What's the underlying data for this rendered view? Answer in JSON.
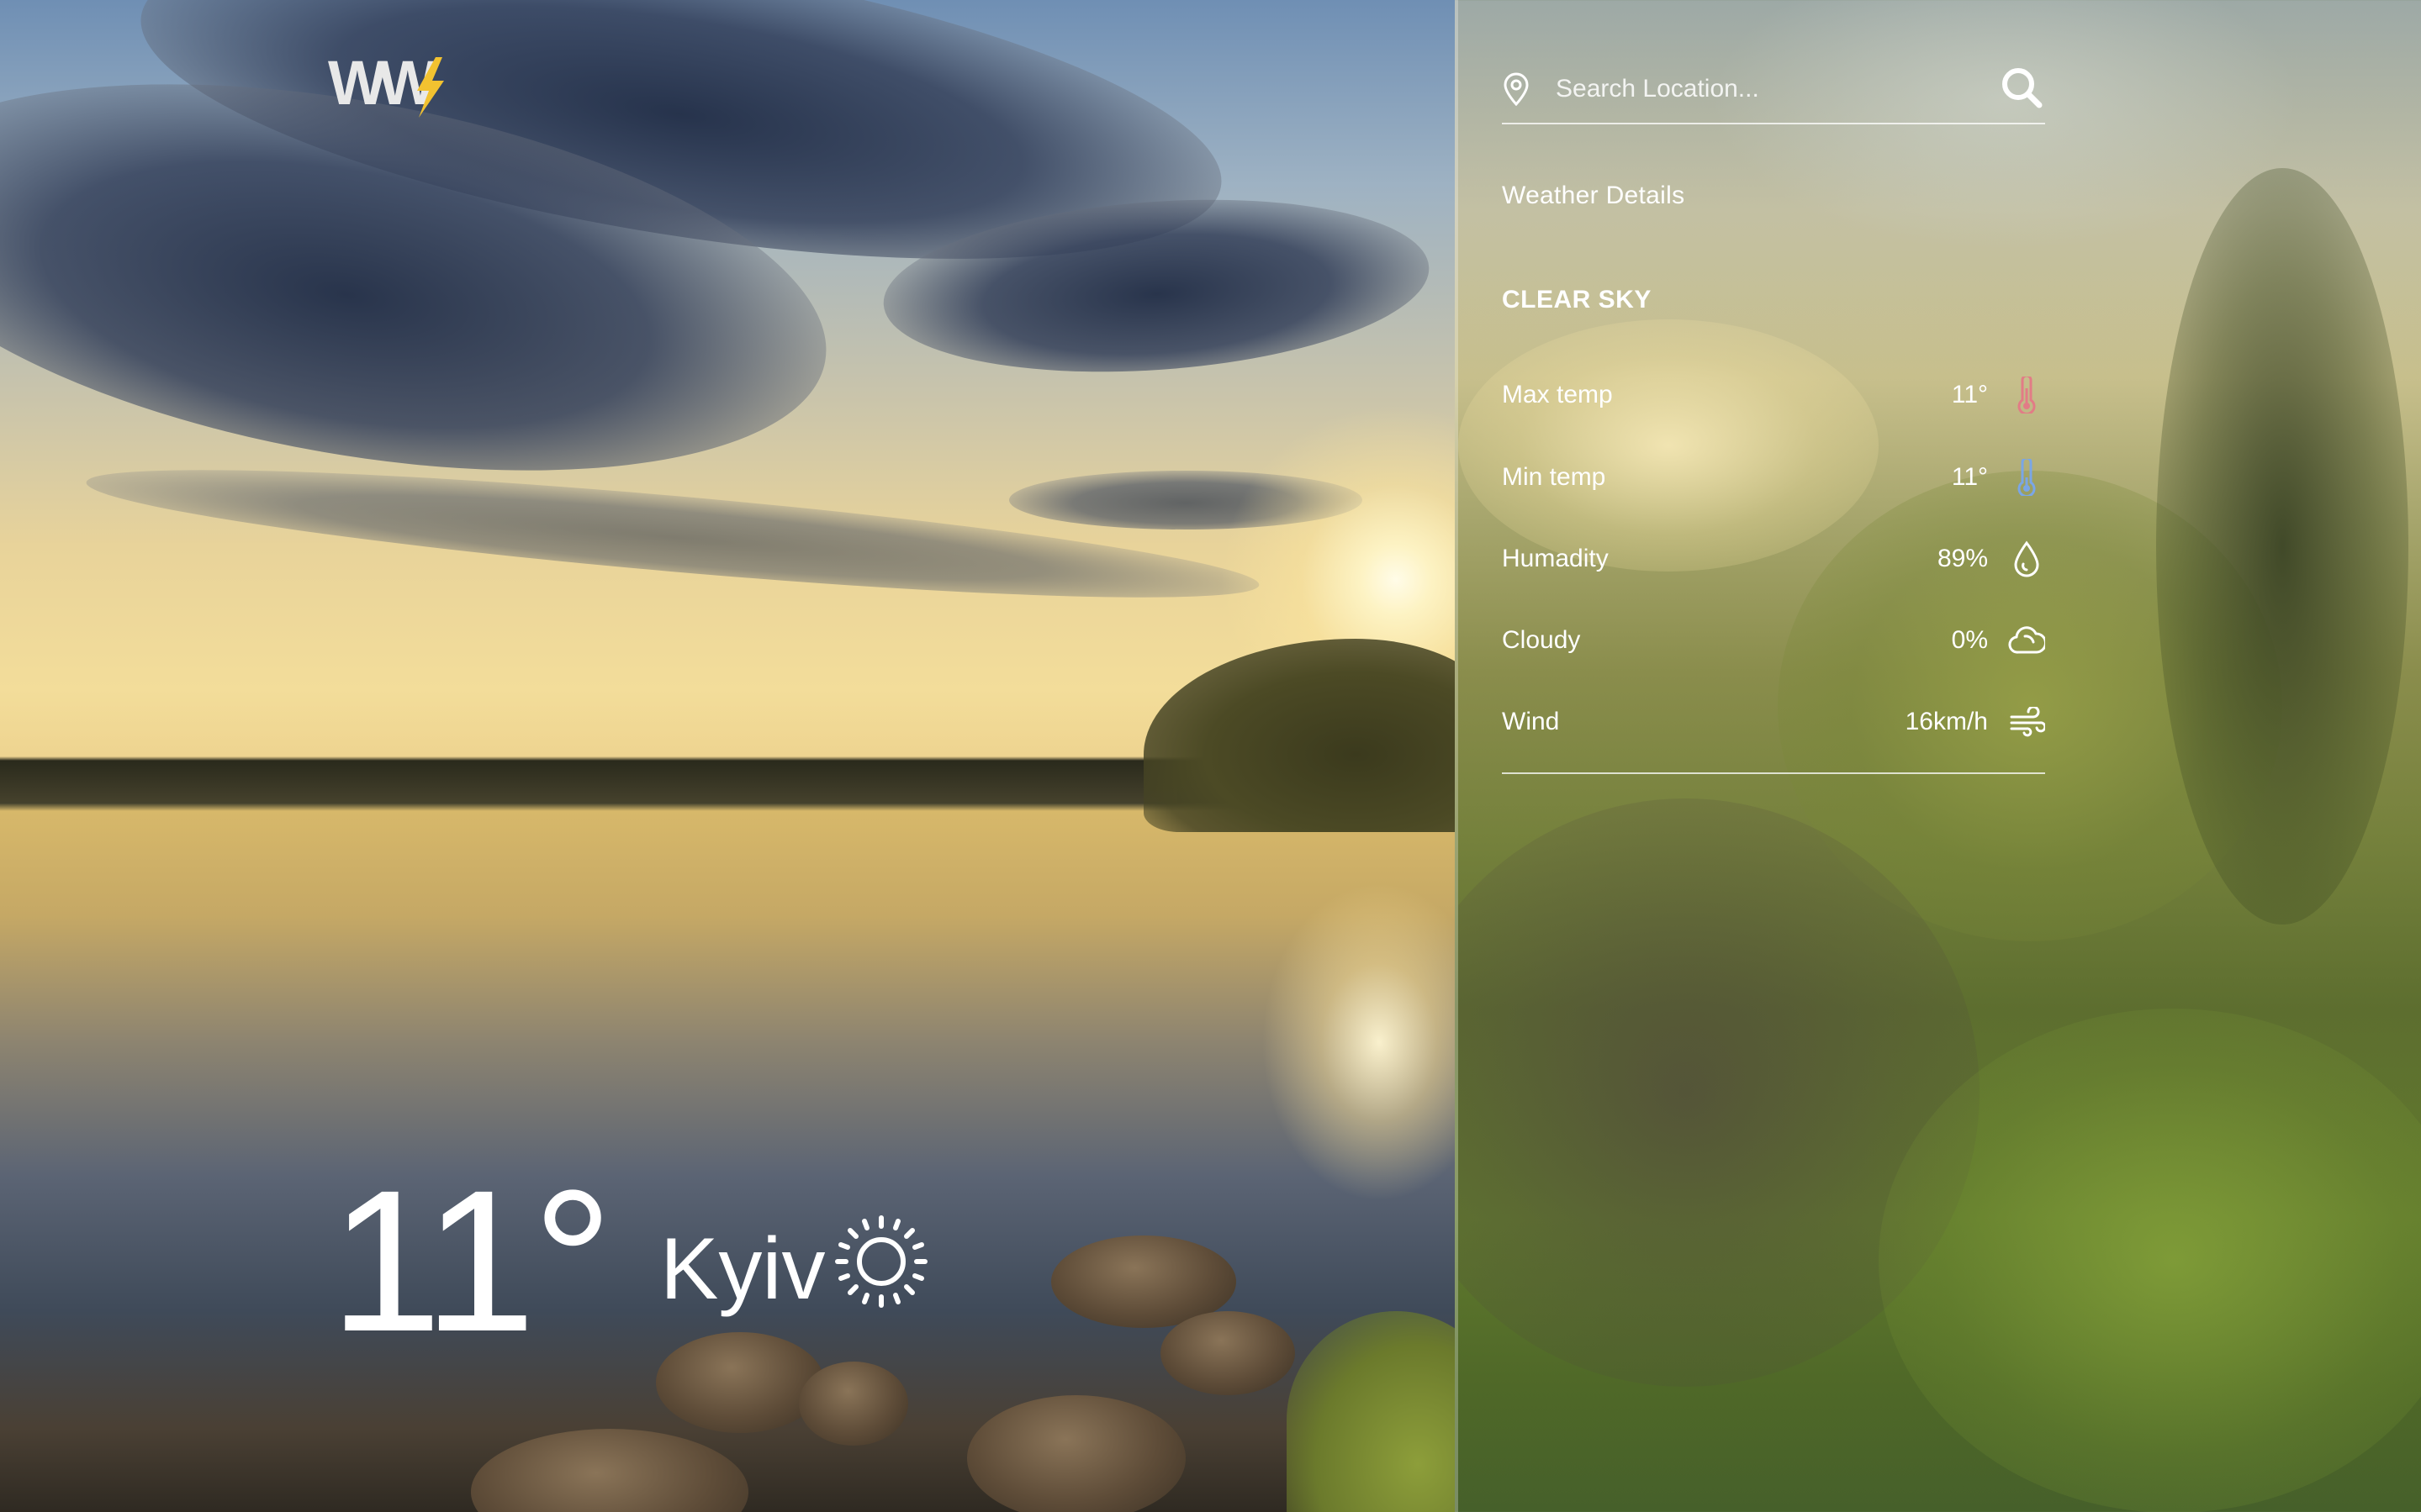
{
  "app": {
    "logo_text": "WW"
  },
  "search": {
    "placeholder": "Search Location...",
    "value": ""
  },
  "details": {
    "title": "Weather Details",
    "condition": "CLEAR SKY",
    "items": [
      {
        "label": "Max temp",
        "value": "11°",
        "icon": "thermometer-hot-icon",
        "icon_color": "#e27c86"
      },
      {
        "label": "Min temp",
        "value": "11°",
        "icon": "thermometer-cold-icon",
        "icon_color": "#7aa6e6"
      },
      {
        "label": "Humadity",
        "value": "89%",
        "icon": "droplet-icon",
        "icon_color": "#ffffff"
      },
      {
        "label": "Cloudy",
        "value": "0%",
        "icon": "cloud-icon",
        "icon_color": "#ffffff"
      },
      {
        "label": "Wind",
        "value": "16km/h",
        "icon": "wind-icon",
        "icon_color": "#ffffff"
      }
    ]
  },
  "current": {
    "temperature": "11°",
    "city": "Kyiv",
    "condition_icon": "sun-icon"
  },
  "colors": {
    "logo_bolt": "#f2c230",
    "text": "#ffffff"
  }
}
